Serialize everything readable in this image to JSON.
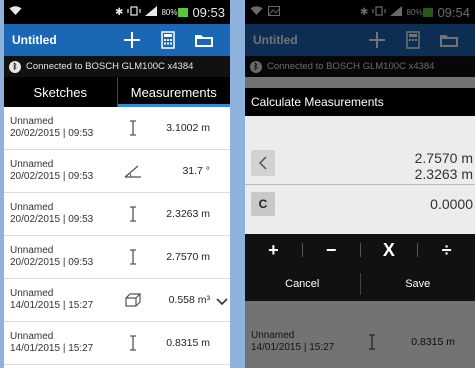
{
  "status_bar": {
    "battery": "80%",
    "time_left": "09:53",
    "time_right": "09:54"
  },
  "action_bar": {
    "title": "Untitled"
  },
  "connection": {
    "text": "Connected to BOSCH GLM100C x4384"
  },
  "tabs": [
    {
      "label": "Sketches",
      "active": false
    },
    {
      "label": "Measurements",
      "active": true
    }
  ],
  "measurements": [
    {
      "name": "Unnamed",
      "datetime": "20/02/2015 | 09:53",
      "icon": "length-icon",
      "value": "3.1002 m"
    },
    {
      "name": "Unnamed",
      "datetime": "20/02/2015 | 09:53",
      "icon": "angle-icon",
      "value": "31.7 °"
    },
    {
      "name": "Unnamed",
      "datetime": "20/02/2015 | 09:53",
      "icon": "length-icon",
      "value": "2.3263 m"
    },
    {
      "name": "Unnamed",
      "datetime": "20/02/2015 | 09:53",
      "icon": "length-icon",
      "value": "2.7570 m"
    },
    {
      "name": "Unnamed",
      "datetime": "14/01/2015 | 15:27",
      "icon": "volume-icon",
      "value": "0.558 m³"
    },
    {
      "name": "Unnamed",
      "datetime": "14/01/2015 | 15:27",
      "icon": "length-icon",
      "value": "0.8315 m"
    }
  ],
  "dialog": {
    "title": "Calculate Measurements",
    "display_line1": "2.7570 m",
    "display_line2": "2.3263 m",
    "result": "0.0000",
    "operators": [
      "+",
      "−",
      "X",
      "÷"
    ],
    "cancel_label": "Cancel",
    "save_label": "Save"
  },
  "background_row": {
    "name": "Unnamed",
    "datetime": "14/01/2015 | 15:27",
    "value": "0.8315 m"
  },
  "colors": {
    "action_bar": "#1a67b5",
    "tab_indicator": "#3a86d6",
    "battery": "#5cc63b",
    "backdrop": "#8fb2dd"
  }
}
